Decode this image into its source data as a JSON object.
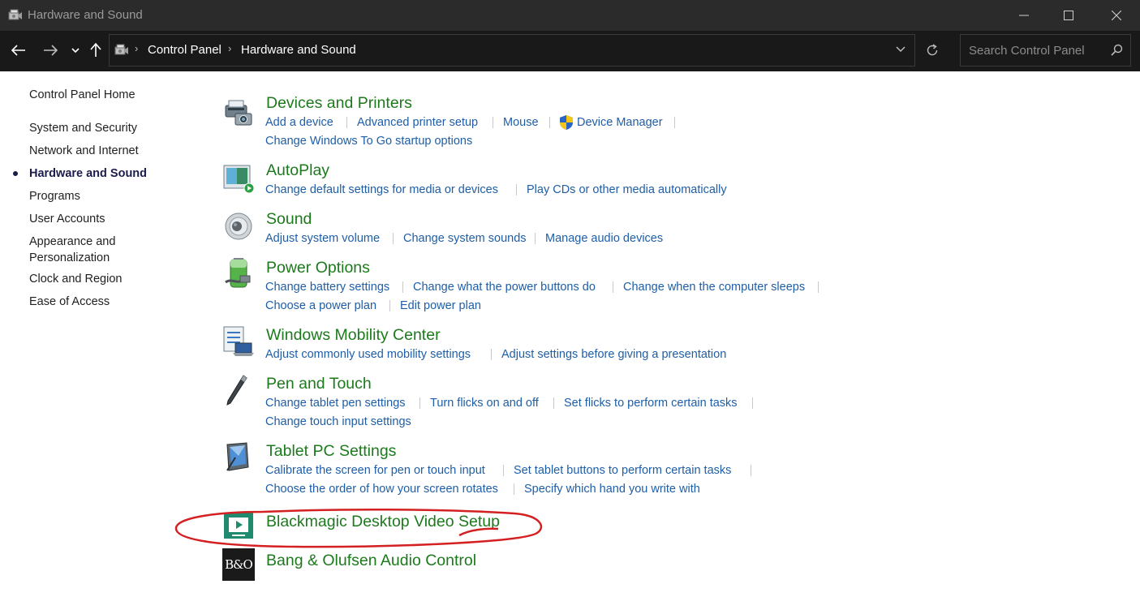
{
  "window": {
    "title": "Hardware and Sound"
  },
  "address_bar": {
    "breadcrumbs": [
      "Control Panel",
      "Hardware and Sound"
    ],
    "search_placeholder": "Search Control Panel"
  },
  "left_nav": {
    "home": "Control Panel Home",
    "items": [
      "System and Security",
      "Network and Internet",
      "Hardware and Sound",
      "Programs",
      "User Accounts",
      "Appearance and",
      "Personalization",
      "Clock and Region",
      "Ease of Access"
    ],
    "current": "Hardware and Sound"
  },
  "categories": [
    {
      "title": "Devices and Printers",
      "icon": "printer-camera-icon",
      "links": [
        "Add a device",
        "Advanced printer setup",
        "Mouse",
        "Device Manager",
        "Change Windows To Go startup options"
      ]
    },
    {
      "title": "AutoPlay",
      "icon": "autoplay-icon",
      "links": [
        "Change default settings for media or devices",
        "Play CDs or other media automatically"
      ]
    },
    {
      "title": "Sound",
      "icon": "speaker-icon",
      "links": [
        "Adjust system volume",
        "Change system sounds",
        "Manage audio devices"
      ]
    },
    {
      "title": "Power Options",
      "icon": "battery-icon",
      "links": [
        "Change battery settings",
        "Change what the power buttons do",
        "Change when the computer sleeps",
        "Choose a power plan",
        "Edit power plan"
      ]
    },
    {
      "title": "Windows Mobility Center",
      "icon": "mobility-center-icon",
      "links": [
        "Adjust commonly used mobility settings",
        "Adjust settings before giving a presentation"
      ]
    },
    {
      "title": "Pen and Touch",
      "icon": "pen-icon",
      "links": [
        "Change tablet pen settings",
        "Turn flicks on and off",
        "Set flicks to perform certain tasks",
        "Change touch input settings"
      ]
    },
    {
      "title": "Tablet PC Settings",
      "icon": "tablet-pc-icon",
      "links": [
        "Calibrate the screen for pen or touch input",
        "Set tablet buttons to perform certain tasks",
        "Choose the order of how your screen rotates",
        "Specify which hand you write with"
      ]
    },
    {
      "title": "Blackmagic Desktop Video Setup",
      "icon": "blackmagic-icon",
      "links": []
    },
    {
      "title": "Bang & Olufsen Audio Control",
      "icon": "bang-olufsen-icon",
      "logo_text": "B&O",
      "links": []
    }
  ],
  "colors": {
    "title_bar": "#2b2b2b",
    "nav_bar": "#191919",
    "category_title": "#1c7a1c",
    "link": "#1e5ea8",
    "annotation": "#d42020"
  }
}
